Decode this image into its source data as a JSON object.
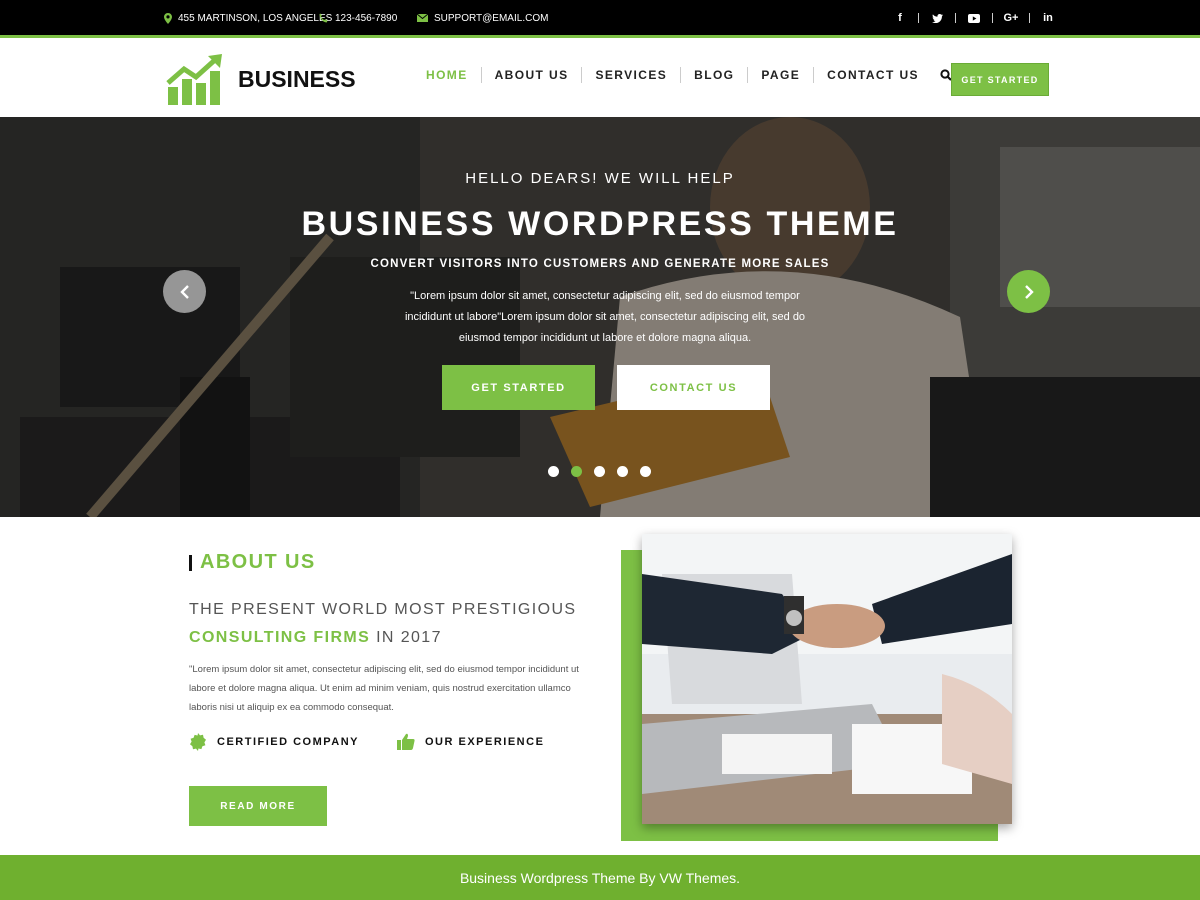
{
  "topbar": {
    "address": "455 MARTINSON, LOS ANGELES",
    "phone": "123-456-7890",
    "email": "SUPPORT@EMAIL.COM",
    "socials": [
      "f",
      "t",
      "yt",
      "G+",
      "in"
    ]
  },
  "header": {
    "logo_text": "BUSINESS",
    "nav": [
      "HOME",
      "ABOUT US",
      "SERVICES",
      "BLOG",
      "PAGE",
      "CONTACT US"
    ],
    "active_nav": "HOME",
    "cta": "GET STARTED"
  },
  "hero": {
    "kicker": "HELLO DEARS! WE WILL HELP",
    "title": "BUSINESS WORDPRESS THEME",
    "subtitle": "CONVERT VISITORS INTO CUSTOMERS AND GENERATE MORE SALES",
    "description": "\"Lorem ipsum dolor sit amet, consectetur adipiscing elit, sed do eiusmod tempor incididunt ut labore\"Lorem ipsum dolor sit amet, consectetur adipiscing elit, sed do eiusmod tempor incididunt ut labore et dolore magna aliqua.",
    "primary_button": "GET STARTED",
    "secondary_button": "CONTACT US",
    "slide_count": 5,
    "active_slide": 2
  },
  "about": {
    "heading": "ABOUT US",
    "sub_line1": "THE PRESENT WORLD MOST PRESTIGIOUS",
    "sub_highlight": "CONSULTING FIRMS",
    "sub_rest": " IN 2017",
    "description": "\"Lorem ipsum dolor sit amet, consectetur adipiscing elit, sed do eiusmod tempor incididunt ut labore et dolore magna aliqua. Ut enim ad minim veniam, quis nostrud exercitation ullamco laboris nisi ut aliquip ex ea commodo consequat.",
    "feature1": "CERTIFIED COMPANY",
    "feature2": "OUR EXPERIENCE",
    "button": "READ MORE"
  },
  "footer": {
    "text": "Business Wordpress Theme By VW Themes."
  },
  "colors": {
    "accent": "#7dc045",
    "topbar": "#000000",
    "footer": "#6fb02f"
  }
}
